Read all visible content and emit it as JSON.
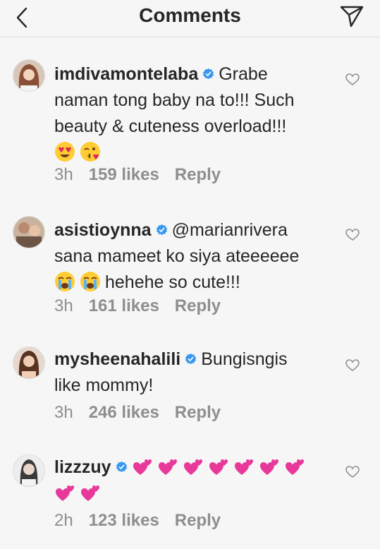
{
  "header": {
    "title": "Comments"
  },
  "comments": [
    {
      "username": "imdivamontelaba",
      "lines": [
        "Grabe",
        "naman tong baby na to!!! Such",
        "beauty & cuteness overload!!!"
      ],
      "emojis": [
        "heart-eyes-emoji",
        "kissing-face-emoji"
      ],
      "time": "3h",
      "likes": "159 likes",
      "reply": "Reply"
    },
    {
      "username": "asistioynna",
      "mention": "@marianrivera",
      "lines": [
        "sana mameet ko siya ateeeeee",
        "hehehe so cute!!!"
      ],
      "emojis": [
        "crying-face-emoji",
        "crying-face-emoji"
      ],
      "time": "3h",
      "likes": "161 likes",
      "reply": "Reply"
    },
    {
      "username": "mysheenahalili",
      "lines": [
        "Bungisngis",
        "like mommy!"
      ],
      "time": "3h",
      "likes": "246 likes",
      "reply": "Reply"
    },
    {
      "username": "lizzzuy",
      "heart_count": 9,
      "time": "2h",
      "likes": "123 likes",
      "reply": "Reply"
    }
  ],
  "colors": {
    "verified": "#3897f0",
    "hearts": "#e8399a",
    "meta": "#8e8e8e"
  },
  "icons": [
    "back-icon",
    "send-icon",
    "verified-icon",
    "like-heart-icon",
    "two-hearts-emoji"
  ]
}
